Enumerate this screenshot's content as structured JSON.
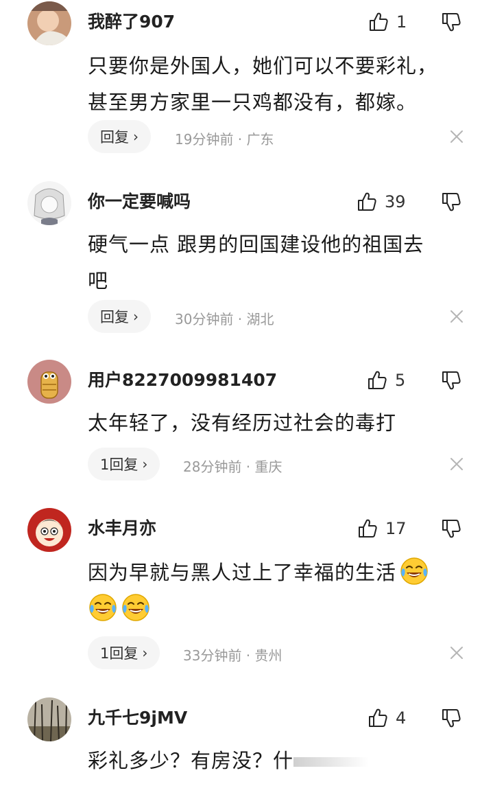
{
  "colors": {
    "text": "#1a1a1a",
    "meta": "#999999",
    "reply_bg": "#f5f5f5"
  },
  "comments": [
    {
      "username": "我醉了907",
      "avatar_icon": "baby-photo-avatar",
      "likes": "1",
      "lines": [
        "只要你是外国人，她们可以不要彩礼，",
        "甚至男方家里一只鸡都没有，都嫁。"
      ],
      "reply_label": "回复",
      "meta": "19分钟前 · 广东"
    },
    {
      "username": "你一定要喊吗",
      "avatar_icon": "anime-sketch-avatar",
      "likes": "39",
      "lines": [
        "硬气一点 跟男的回国建设他的祖国去",
        "吧"
      ],
      "reply_label": "回复",
      "meta": "30分钟前 · 湖北"
    },
    {
      "username": "用户8227009981407",
      "avatar_icon": "cartoon-bread-avatar",
      "likes": "5",
      "lines": [
        "太年轻了，没有经历过社会的毒打"
      ],
      "reply_label": "1回复",
      "meta": "28分钟前 · 重庆"
    },
    {
      "username": "水丰月亦",
      "avatar_icon": "cartoon-face-avatar",
      "likes": "17",
      "lines": [
        "因为早就与黑人过上了幸福的生活"
      ],
      "emojis": [
        "laugh-cry-emoji",
        "laugh-cry-emoji",
        "laugh-cry-emoji"
      ],
      "reply_label": "1回复",
      "meta": "33分钟前 · 贵州"
    },
    {
      "username": "九千七9jMV",
      "avatar_icon": "forest-photo-avatar",
      "likes": "4",
      "lines": [
        "彩礼多少？有房没？什"
      ]
    }
  ]
}
